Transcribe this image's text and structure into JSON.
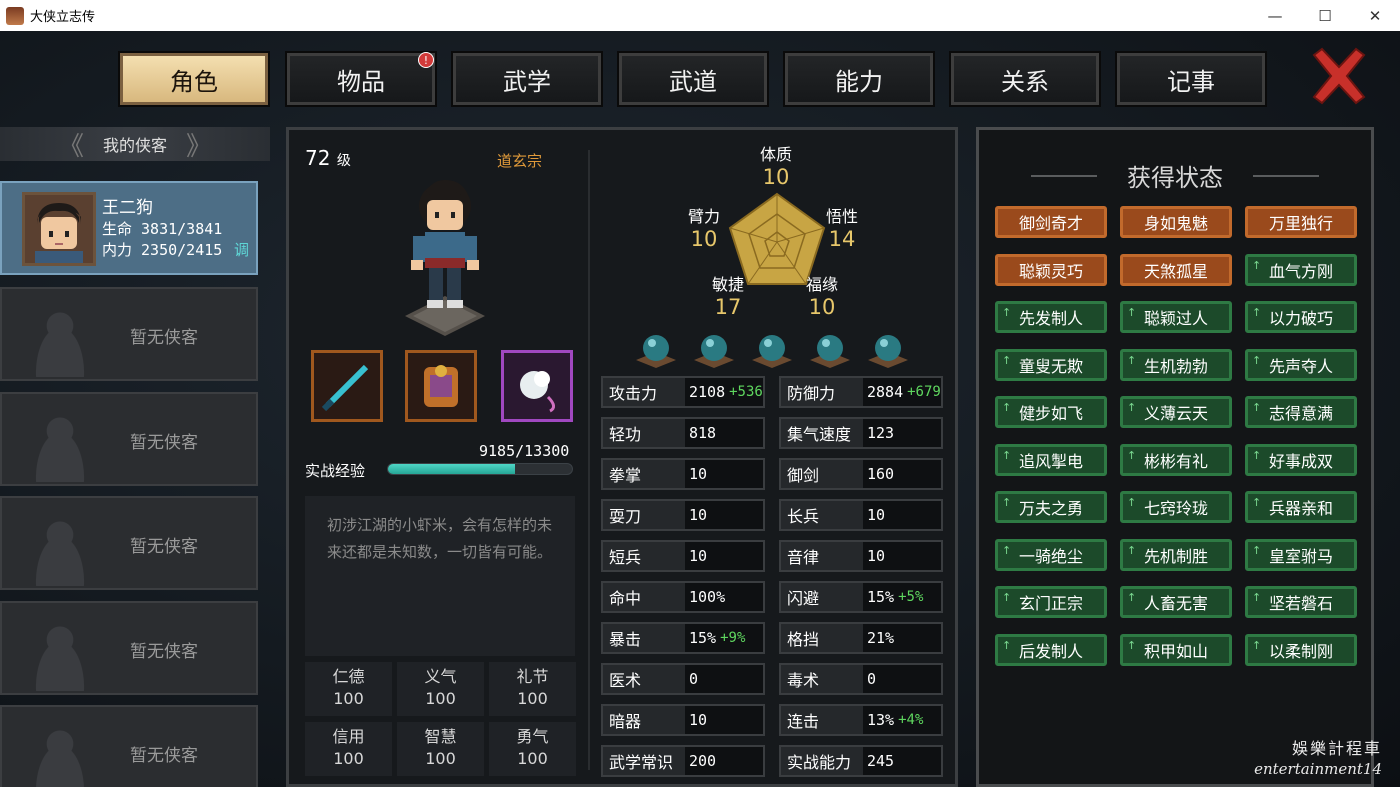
{
  "window": {
    "title": "大侠立志传",
    "min": "—",
    "max": "☐",
    "close": "✕"
  },
  "tabs": [
    {
      "label": "角色",
      "active": true
    },
    {
      "label": "物品",
      "badge": "!"
    },
    {
      "label": "武学"
    },
    {
      "label": "武道"
    },
    {
      "label": "能力"
    },
    {
      "label": "关系"
    },
    {
      "label": "记事"
    }
  ],
  "sidebar": {
    "header": "我的侠客",
    "active_character": {
      "name": "王二狗",
      "hp": "生命 3831/3841",
      "mp": "内力 2350/2415",
      "adjust": "调"
    },
    "empty_label": "暂无侠客"
  },
  "profile": {
    "level": "72",
    "level_unit": "级",
    "sect": "道玄宗",
    "exp_label": "实战经验",
    "exp_value": "9185/13300",
    "exp_fraction": 0.69,
    "description": "初涉江湖的小虾米，会有怎样的未来还都是未知数，一切皆有可能。",
    "virtues": [
      {
        "name": "仁德",
        "value": "100"
      },
      {
        "name": "义气",
        "value": "100"
      },
      {
        "name": "礼节",
        "value": "100"
      },
      {
        "name": "信用",
        "value": "100"
      },
      {
        "name": "智慧",
        "value": "100"
      },
      {
        "name": "勇气",
        "value": "100"
      }
    ]
  },
  "radar": {
    "top": {
      "name": "体质",
      "value": "10"
    },
    "upper_left": {
      "name": "臂力",
      "value": "10"
    },
    "upper_right": {
      "name": "悟性",
      "value": "14"
    },
    "lower_left": {
      "name": "敏捷",
      "value": "17"
    },
    "lower_right": {
      "name": "福缘",
      "value": "10"
    }
  },
  "stats_left": [
    {
      "name": "攻击力",
      "value": "2108",
      "bonus": "+536"
    },
    {
      "name": "轻功",
      "value": "818",
      "bonus": ""
    },
    {
      "name": "拳掌",
      "value": "10",
      "bonus": ""
    },
    {
      "name": "耍刀",
      "value": "10",
      "bonus": ""
    },
    {
      "name": "短兵",
      "value": "10",
      "bonus": ""
    },
    {
      "name": "命中",
      "value": "100%",
      "bonus": ""
    },
    {
      "name": "暴击",
      "value": "15%",
      "bonus": "+9%"
    },
    {
      "name": "医术",
      "value": "0",
      "bonus": ""
    },
    {
      "name": "暗器",
      "value": "10",
      "bonus": ""
    },
    {
      "name": "武学常识",
      "value": "200",
      "bonus": ""
    }
  ],
  "stats_right": [
    {
      "name": "防御力",
      "value": "2884",
      "bonus": "+679"
    },
    {
      "name": "集气速度",
      "value": "123",
      "bonus": ""
    },
    {
      "name": "御剑",
      "value": "160",
      "bonus": ""
    },
    {
      "name": "长兵",
      "value": "10",
      "bonus": ""
    },
    {
      "name": "音律",
      "value": "10",
      "bonus": ""
    },
    {
      "name": "闪避",
      "value": "15%",
      "bonus": "+5%"
    },
    {
      "name": "格挡",
      "value": "21%",
      "bonus": ""
    },
    {
      "name": "毒术",
      "value": "0",
      "bonus": ""
    },
    {
      "name": "连击",
      "value": "13%",
      "bonus": "+4%"
    },
    {
      "name": "实战能力",
      "value": "245",
      "bonus": ""
    }
  ],
  "status_panel": {
    "title": "获得状态",
    "buffs": [
      {
        "label": "御剑奇才",
        "color": "orange"
      },
      {
        "label": "身如鬼魅",
        "color": "orange"
      },
      {
        "label": "万里独行",
        "color": "orange"
      },
      {
        "label": "聪颖灵巧",
        "color": "orange"
      },
      {
        "label": "天煞孤星",
        "color": "orange"
      },
      {
        "label": "血气方刚",
        "color": "green"
      },
      {
        "label": "先发制人",
        "color": "green"
      },
      {
        "label": "聪颖过人",
        "color": "green"
      },
      {
        "label": "以力破巧",
        "color": "green"
      },
      {
        "label": "童叟无欺",
        "color": "green"
      },
      {
        "label": "生机勃勃",
        "color": "green"
      },
      {
        "label": "先声夺人",
        "color": "green"
      },
      {
        "label": "健步如飞",
        "color": "green"
      },
      {
        "label": "义薄云天",
        "color": "green"
      },
      {
        "label": "志得意满",
        "color": "green"
      },
      {
        "label": "追风掣电",
        "color": "green"
      },
      {
        "label": "彬彬有礼",
        "color": "green"
      },
      {
        "label": "好事成双",
        "color": "green"
      },
      {
        "label": "万夫之勇",
        "color": "green"
      },
      {
        "label": "七窍玲珑",
        "color": "green"
      },
      {
        "label": "兵器亲和",
        "color": "green"
      },
      {
        "label": "一骑绝尘",
        "color": "green"
      },
      {
        "label": "先机制胜",
        "color": "green"
      },
      {
        "label": "皇室驸马",
        "color": "green"
      },
      {
        "label": "玄门正宗",
        "color": "green"
      },
      {
        "label": "人畜无害",
        "color": "green"
      },
      {
        "label": "坚若磐石",
        "color": "green"
      },
      {
        "label": "后发制人",
        "color": "green"
      },
      {
        "label": "积甲如山",
        "color": "green"
      },
      {
        "label": "以柔制刚",
        "color": "green"
      }
    ]
  },
  "watermark": {
    "cn": "娛樂計程車",
    "en": "entertainment14"
  },
  "colors": {
    "accent_gold": "#e7c76b",
    "bonus_green": "#5fd75f",
    "sect_orange": "#e09a3a",
    "exp_teal": "#3fc6b6"
  }
}
